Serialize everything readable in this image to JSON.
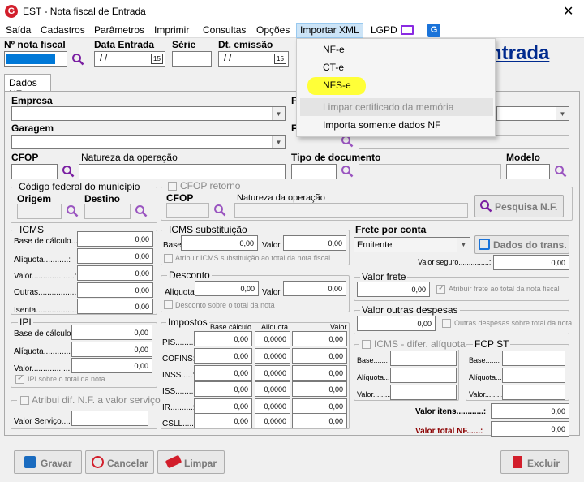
{
  "window": {
    "title": "EST - Nota fiscal de Entrada",
    "close_glyph": "✕"
  },
  "menu": [
    "Saída",
    "Cadastros",
    "Parâmetros",
    "Imprimir",
    "Consultas",
    "Opções",
    "Importar XML",
    "LGPD"
  ],
  "dropdown": {
    "items": [
      "NF-e",
      "CT-e",
      "NFS-e"
    ],
    "disabled_item": "Limpar certificado da memória",
    "last_item": "Importa somente dados NF"
  },
  "header": {
    "nota_label": "Nº nota fiscal",
    "data_entrada_label": "Data Entrada",
    "data_entrada_value": " / /",
    "serie_label": "Série",
    "dt_emissao_label": "Dt. emissão",
    "dt_emissao_value": " / /",
    "calendar_glyph": "15",
    "big_title_fragment": "ntrada"
  },
  "tab": "Dados NF",
  "fields": {
    "empresa": "Empresa",
    "f_label": "F",
    "garagem": "Garagem",
    "cfop": "CFOP",
    "natureza": "Natureza da operação",
    "tipo_documento": "Tipo de documento",
    "modelo": "Modelo"
  },
  "municipio": {
    "title": "Código federal do município",
    "origem": "Origem",
    "destino": "Destino"
  },
  "cfop_retorno": {
    "title": "CFOP retorno",
    "cfop": "CFOP",
    "natureza": "Natureza da operação",
    "button": "Pesquisa N.F."
  },
  "icms": {
    "title": "ICMS",
    "labels": [
      "Base de cálculo...:",
      "Alíquota...........:",
      "Valor...................:",
      "Outras...................:",
      "Isenta......................:"
    ],
    "values": [
      "0,00",
      "0,00",
      "0,00",
      "0,00",
      "0,00"
    ]
  },
  "icms_st": {
    "title": "ICMS substituição",
    "base": "Base",
    "base_value": "0,00",
    "valor": "Valor",
    "valor_value": "0,00",
    "check": "Atribuir ICMS substituição ao total da nota fiscal"
  },
  "desconto": {
    "title": "Desconto",
    "aliquota": "Alíquota",
    "aliquota_value": "0,00",
    "valor": "Valor",
    "valor_value": "0,00",
    "check": "Desconto sobre o total da nota"
  },
  "frete": {
    "title": "Frete por conta",
    "value": "Emitente",
    "button": "Dados do trans.",
    "valor_seguro": "Valor seguro...............:",
    "valor_seguro_value": "0,00"
  },
  "valor_frete": {
    "title": "Valor frete",
    "value": "0,00",
    "check": "Atribuir frete ao total da nota fiscal"
  },
  "outras_despesas": {
    "title": "Valor outras despesas",
    "value": "0,00",
    "check": "Outras despesas sobre total da nota"
  },
  "ipi": {
    "title": "IPI",
    "labels": [
      "Base de cálculo..:",
      "Alíquota..............:",
      "Valor....................:"
    ],
    "values": [
      "0,00",
      "0,00",
      "0,00"
    ],
    "check": "IPI sobre o total da nota"
  },
  "atribuir_dif": {
    "title": "Atribui dif. N.F. a valor serviço",
    "valor_servico": "Valor Serviço............:"
  },
  "impostos": {
    "title": "Impostos",
    "col_base": "Base cálculo",
    "col_aliq": "Alíquota",
    "col_valor": "Valor",
    "rows": [
      {
        "label": "PIS.........:",
        "base": "0,00",
        "aliq": "0,0000",
        "valor": "0,00"
      },
      {
        "label": "COFINS:",
        "base": "0,00",
        "aliq": "0,0000",
        "valor": "0,00"
      },
      {
        "label": "INSS.....:",
        "base": "0,00",
        "aliq": "0,0000",
        "valor": "0,00"
      },
      {
        "label": "ISS.........:",
        "base": "0,00",
        "aliq": "0,0000",
        "valor": "0,00"
      },
      {
        "label": "IR..........:",
        "base": "0,00",
        "aliq": "0,0000",
        "valor": "0,00"
      },
      {
        "label": "CSLL.......:",
        "base": "0,00",
        "aliq": "0,0000",
        "valor": "0,00"
      }
    ]
  },
  "icms_difer": {
    "title": "ICMS - difer. alíquota",
    "labels": [
      "Base......:",
      "Alíquota...:",
      "Valor.........:"
    ]
  },
  "fcp_st": {
    "title": "FCP ST",
    "labels": [
      "Base......:",
      "Alíquota...:",
      "Valor.........:"
    ]
  },
  "totals": {
    "itens_label": "Valor itens............:",
    "itens_value": "0,00",
    "total_label": "Valor total NF......:",
    "total_value": "0,00"
  },
  "buttons": {
    "gravar": "Gravar",
    "cancelar": "Cancelar",
    "limpar": "Limpar",
    "excluir": "Excluir"
  }
}
